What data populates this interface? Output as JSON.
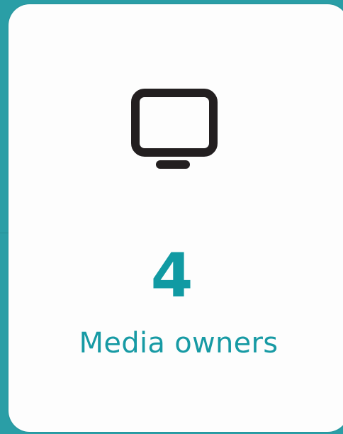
{
  "card": {
    "icon": "monitor-icon",
    "count": "4",
    "label": "Media owners"
  },
  "colors": {
    "background": "#2a9ea6",
    "card": "#fdfdfd",
    "accent": "#119aa3",
    "icon": "#231f20"
  }
}
